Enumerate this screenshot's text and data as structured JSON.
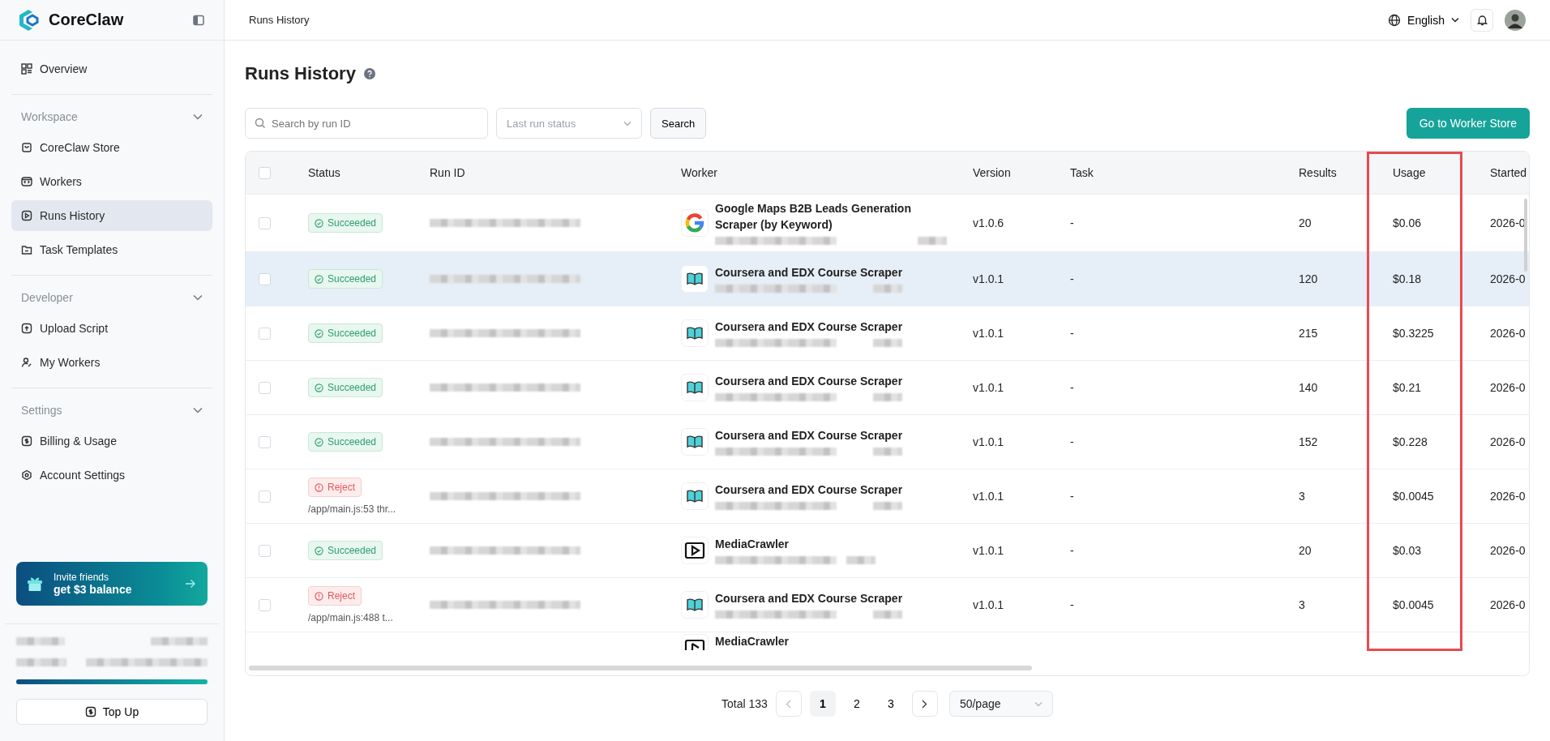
{
  "brand": {
    "name": "CoreClaw"
  },
  "sidebar": {
    "top_items": [
      {
        "label": "Overview",
        "selected": false
      }
    ],
    "sections": [
      {
        "title": "Workspace",
        "expanded": true,
        "items": [
          {
            "label": "CoreClaw Store",
            "selected": false
          },
          {
            "label": "Workers",
            "selected": false
          },
          {
            "label": "Runs History",
            "selected": true
          },
          {
            "label": "Task Templates",
            "selected": false
          }
        ]
      },
      {
        "title": "Developer",
        "expanded": true,
        "items": [
          {
            "label": "Upload Script",
            "selected": false
          },
          {
            "label": "My Workers",
            "selected": false
          }
        ]
      },
      {
        "title": "Settings",
        "expanded": true,
        "items": [
          {
            "label": "Billing & Usage",
            "selected": false
          },
          {
            "label": "Account Settings",
            "selected": false
          }
        ]
      }
    ],
    "invite": {
      "line1": "Invite friends",
      "line2": "get $3 balance"
    },
    "usage_meter": {
      "level": 1
    },
    "top_up": "Top Up"
  },
  "header": {
    "breadcrumb": "Runs History",
    "language": "English"
  },
  "page": {
    "title": "Runs History",
    "search": {
      "placeholder": "Search by run ID"
    },
    "status_filter": {
      "placeholder": "Last run status"
    },
    "search_button": "Search",
    "store_button": "Go to Worker Store"
  },
  "table": {
    "select_all": {
      "checked": false
    },
    "columns": [
      {
        "label": "Status",
        "highlighted": false
      },
      {
        "label": "Run ID",
        "highlighted": false
      },
      {
        "label": "Worker",
        "highlighted": false
      },
      {
        "label": "Version",
        "highlighted": false
      },
      {
        "label": "Task",
        "highlighted": false
      },
      {
        "label": "Results",
        "highlighted": false
      },
      {
        "label": "Usage",
        "highlighted": true
      },
      {
        "label": "Started",
        "highlighted": false
      }
    ],
    "rows": [
      {
        "checked": false,
        "highlighted": false,
        "status": {
          "kind": "succeeded",
          "label": "Succeeded"
        },
        "worker": {
          "kind": "google",
          "name": "Google Maps B2B Leads Generation Scraper (by Keyword)"
        },
        "version": "v1.0.6",
        "task": "-",
        "results": "20",
        "usage": "$0.06",
        "started": "2026-0"
      },
      {
        "checked": false,
        "highlighted": true,
        "status": {
          "kind": "succeeded",
          "label": "Succeeded"
        },
        "worker": {
          "kind": "book",
          "name": "Coursera and EDX Course Scraper"
        },
        "version": "v1.0.1",
        "task": "-",
        "results": "120",
        "usage": "$0.18",
        "started": "2026-0"
      },
      {
        "checked": false,
        "highlighted": false,
        "status": {
          "kind": "succeeded",
          "label": "Succeeded"
        },
        "worker": {
          "kind": "book",
          "name": "Coursera and EDX Course Scraper"
        },
        "version": "v1.0.1",
        "task": "-",
        "results": "215",
        "usage": "$0.3225",
        "started": "2026-0"
      },
      {
        "checked": false,
        "highlighted": false,
        "status": {
          "kind": "succeeded",
          "label": "Succeeded"
        },
        "worker": {
          "kind": "book",
          "name": "Coursera and EDX Course Scraper"
        },
        "version": "v1.0.1",
        "task": "-",
        "results": "140",
        "usage": "$0.21",
        "started": "2026-0"
      },
      {
        "checked": false,
        "highlighted": false,
        "status": {
          "kind": "succeeded",
          "label": "Succeeded"
        },
        "worker": {
          "kind": "book",
          "name": "Coursera and EDX Course Scraper"
        },
        "version": "v1.0.1",
        "task": "-",
        "results": "152",
        "usage": "$0.228",
        "started": "2026-0"
      },
      {
        "checked": false,
        "highlighted": false,
        "status": {
          "kind": "reject",
          "label": "Reject",
          "detail": "/app/main.js:53 thr..."
        },
        "worker": {
          "kind": "book",
          "name": "Coursera and EDX Course Scraper"
        },
        "version": "v1.0.1",
        "task": "-",
        "results": "3",
        "usage": "$0.0045",
        "started": "2026-0"
      },
      {
        "checked": false,
        "highlighted": false,
        "status": {
          "kind": "succeeded",
          "label": "Succeeded"
        },
        "worker": {
          "kind": "video",
          "name": "MediaCrawler"
        },
        "version": "v1.0.1",
        "task": "-",
        "results": "20",
        "usage": "$0.03",
        "started": "2026-0"
      },
      {
        "checked": false,
        "highlighted": false,
        "status": {
          "kind": "reject",
          "label": "Reject",
          "detail": "/app/main.js:488 t..."
        },
        "worker": {
          "kind": "book",
          "name": "Coursera and EDX Course Scraper"
        },
        "version": "v1.0.1",
        "task": "-",
        "results": "3",
        "usage": "$0.0045",
        "started": "2026-0"
      }
    ],
    "partial_row": {
      "worker": {
        "kind": "video",
        "name": "MediaCrawler"
      }
    }
  },
  "pagination": {
    "total": "Total 133",
    "pages": [
      {
        "label": "1",
        "selected": true
      },
      {
        "label": "2",
        "selected": false
      },
      {
        "label": "3",
        "selected": false
      }
    ],
    "page_size": "50/page"
  }
}
